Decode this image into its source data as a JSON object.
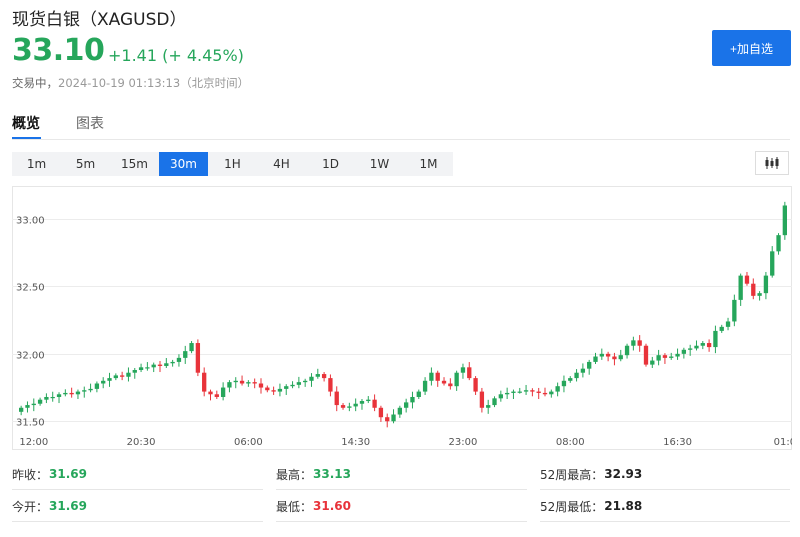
{
  "header": {
    "title": "现货白银（XAGUSD）",
    "price": "33.10",
    "change": "+1.41 (+ 4.45%)",
    "status": "交易中，",
    "timestamp": "2024-10-19 01:13:13（北京时间）",
    "add_button": "+加自选"
  },
  "tabs": [
    {
      "label": "概览",
      "active": true
    },
    {
      "label": "图表",
      "active": false
    }
  ],
  "periods": [
    {
      "label": "1m",
      "active": false
    },
    {
      "label": "5m",
      "active": false
    },
    {
      "label": "15m",
      "active": false
    },
    {
      "label": "30m",
      "active": true
    },
    {
      "label": "1H",
      "active": false
    },
    {
      "label": "4H",
      "active": false
    },
    {
      "label": "1D",
      "active": false
    },
    {
      "label": "1W",
      "active": false
    },
    {
      "label": "1M",
      "active": false
    }
  ],
  "colors": {
    "up": "#26a65b",
    "down": "#e8333a",
    "accent": "#1a73e8"
  },
  "icons": {
    "chart_type": "candlestick-icon"
  },
  "chart_data": {
    "type": "candlestick",
    "interval": "30m",
    "x_tick_labels": [
      "12:00",
      "20:30",
      "06:00",
      "14:30",
      "23:00",
      "08:00",
      "16:30",
      "01:0"
    ],
    "x_tick_index": [
      2,
      19,
      36,
      53,
      70,
      87,
      104,
      121
    ],
    "y_tick_labels": [
      "31.50",
      "32.00",
      "32.50",
      "33.00"
    ],
    "y_tick_values": [
      31.5,
      32.0,
      32.5,
      33.0
    ],
    "ylim": [
      31.45,
      33.2
    ],
    "grid": true,
    "close_values": [
      31.6,
      31.62,
      31.63,
      31.66,
      31.68,
      31.68,
      31.7,
      31.71,
      31.7,
      31.72,
      31.73,
      31.74,
      31.78,
      31.8,
      31.82,
      31.84,
      31.83,
      31.86,
      31.88,
      31.9,
      31.9,
      31.92,
      31.91,
      31.93,
      31.94,
      31.97,
      32.02,
      32.08,
      31.86,
      31.72,
      31.7,
      31.68,
      31.75,
      31.79,
      31.8,
      31.78,
      31.79,
      31.78,
      31.75,
      31.73,
      31.72,
      31.74,
      31.76,
      31.77,
      31.79,
      31.8,
      31.83,
      31.85,
      31.82,
      31.72,
      31.62,
      31.6,
      31.61,
      31.63,
      31.65,
      31.66,
      31.6,
      31.53,
      31.5,
      31.55,
      31.6,
      31.64,
      31.68,
      31.72,
      31.8,
      31.86,
      31.8,
      31.78,
      31.76,
      31.86,
      31.9,
      31.82,
      31.72,
      31.6,
      31.62,
      31.67,
      31.7,
      31.71,
      31.72,
      31.72,
      31.73,
      31.72,
      31.71,
      31.7,
      31.72,
      31.76,
      31.8,
      31.82,
      31.86,
      31.89,
      31.94,
      31.98,
      32.0,
      31.98,
      31.96,
      31.99,
      32.06,
      32.1,
      32.06,
      31.92,
      31.95,
      31.99,
      31.97,
      31.98,
      32.0,
      32.03,
      32.04,
      32.06,
      32.08,
      32.05,
      32.17,
      32.2,
      32.24,
      32.4,
      32.58,
      32.52,
      32.43,
      32.45,
      32.58,
      32.76,
      32.88,
      33.1
    ],
    "last": 33.1
  },
  "stats": [
    {
      "label": "昨收：",
      "value": "31.69",
      "color": "#26a65b"
    },
    {
      "label": "最高：",
      "value": "33.13",
      "color": "#26a65b"
    },
    {
      "label": "52周最高：",
      "value": "32.93",
      "color": "#222222"
    },
    {
      "label": "今开：",
      "value": "31.69",
      "color": "#26a65b"
    },
    {
      "label": "最低：",
      "value": "31.60",
      "color": "#e8333a"
    },
    {
      "label": "52周最低：",
      "value": "21.88",
      "color": "#222222"
    }
  ]
}
